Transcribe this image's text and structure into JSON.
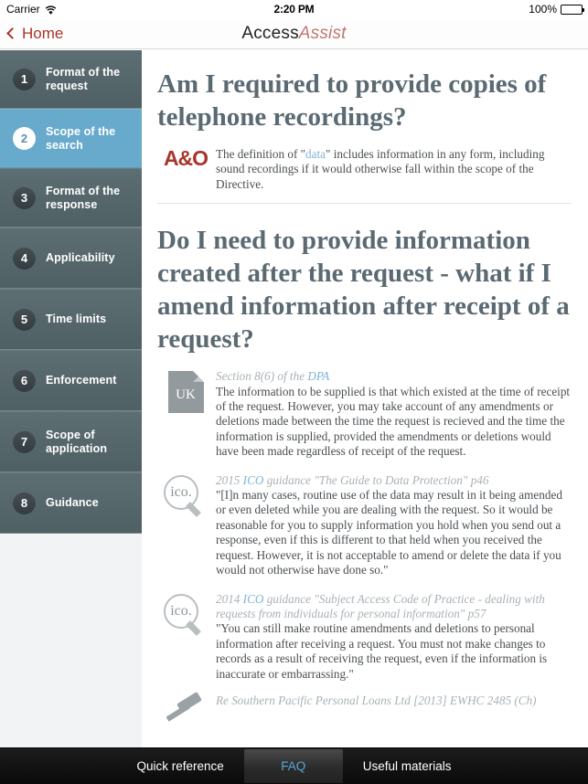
{
  "status_bar": {
    "carrier": "Carrier",
    "wifi_icon": "wifi-icon",
    "time": "2:20 PM",
    "battery_percent": "100%",
    "battery_icon": "battery-full-icon"
  },
  "nav_bar": {
    "back_label": "Home",
    "back_icon": "chevron-left-icon",
    "title_primary": "Access",
    "title_secondary": "Assist"
  },
  "sidebar": {
    "items": [
      {
        "number": "1",
        "label": "Format of the request",
        "selected": false
      },
      {
        "number": "2",
        "label": "Scope of the search",
        "selected": true
      },
      {
        "number": "3",
        "label": "Format of the response",
        "selected": false
      },
      {
        "number": "4",
        "label": "Applicability",
        "selected": false
      },
      {
        "number": "5",
        "label": "Time limits",
        "selected": false
      },
      {
        "number": "6",
        "label": "Enforcement",
        "selected": false
      },
      {
        "number": "7",
        "label": "Scope of application",
        "selected": false
      },
      {
        "number": "8",
        "label": "Guidance",
        "selected": false
      }
    ]
  },
  "main": {
    "question_1": {
      "heading": "Am I required to provide copies of telephone recordings?",
      "entry": {
        "icon": "ao-logo",
        "icon_label": "A&O",
        "text_before_link": "The definition of \"",
        "link_text": "data",
        "text_after_link": "\" includes information in any form, including sound recordings if it would otherwise fall within the scope of the Directive."
      }
    },
    "question_2": {
      "heading": "Do I need to provide information created after the request - what if I amend information after receipt of a request?",
      "entries": [
        {
          "icon": "uk-document-icon",
          "icon_label": "UK",
          "cite_before": "Section 8(6) of the ",
          "cite_link": "DPA",
          "cite_after": "",
          "body": "The information to be supplied is that which existed at the time of receipt of the request. However, you may take account of any amendments or deletions made between the time the request is recieved and the time the information is supplied, provided the amendments or deletions would have been made regardless of receipt of the request."
        },
        {
          "icon": "ico-magnifier-icon",
          "icon_label": "ico.",
          "cite_before": "2015 ",
          "cite_link": "ICO",
          "cite_after": " guidance \"The Guide to Data Protection\" p46",
          "body": "\"[I]n many cases, routine use of the data may result in it being amended or even deleted while you are dealing with the request. So it would be reasonable for you to supply information you hold when you send out a response, even if this is different to that held when you received the request. However, it is not acceptable to amend or delete the data if you would not otherwise have done so.\""
        },
        {
          "icon": "ico-magnifier-icon",
          "icon_label": "ico.",
          "cite_before": "2014 ",
          "cite_link": "ICO",
          "cite_after": " guidance \"Subject Access Code of Practice - dealing with requests from individuals for personal information\" p57",
          "body": "\"You can still make routine amendments and deletions to personal information after receiving a request. You must not make changes to records as a result of receiving the request, even if the information is inaccurate or embarrassing.\""
        },
        {
          "icon": "gavel-icon",
          "icon_label": "",
          "cite_before": "Re Southern Pacific Personal Loans Ltd [2013] EWHC 2485 (Ch)",
          "cite_link": "",
          "cite_after": "",
          "body": ""
        }
      ]
    }
  },
  "tab_bar": {
    "tabs": [
      {
        "label": "Quick reference",
        "selected": false
      },
      {
        "label": "FAQ",
        "selected": true
      },
      {
        "label": "Useful materials",
        "selected": false
      }
    ]
  }
}
